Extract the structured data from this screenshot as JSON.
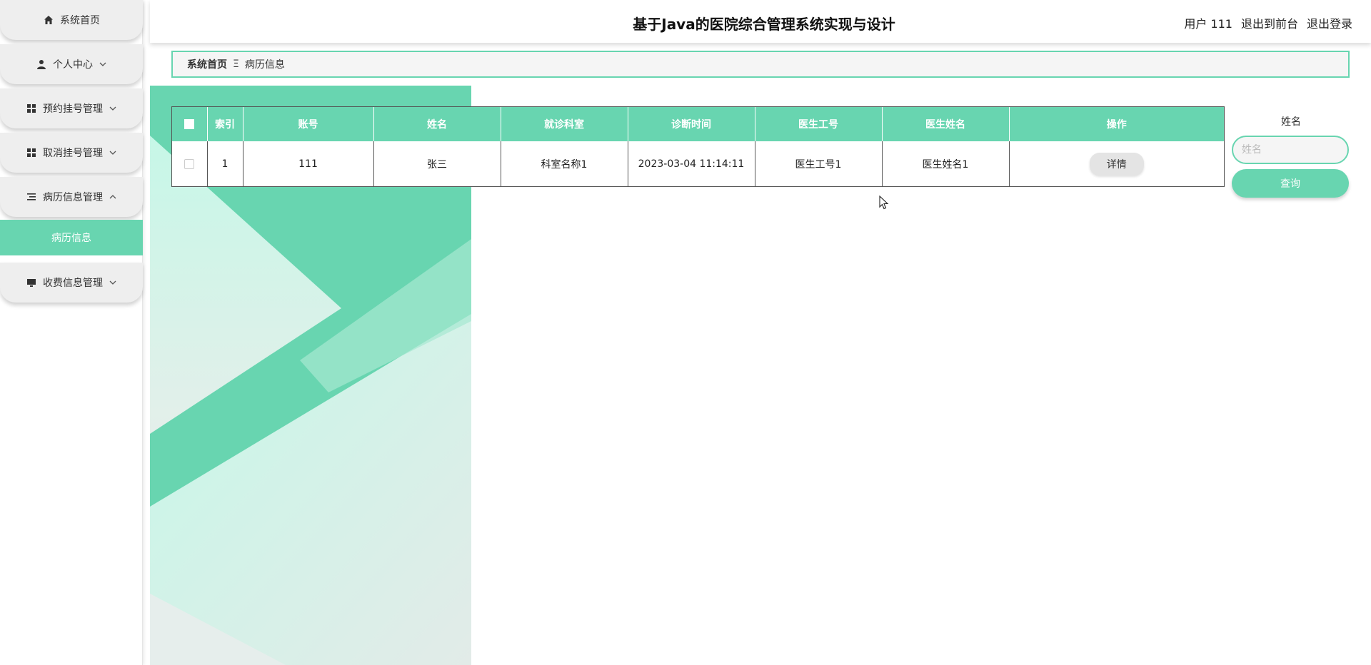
{
  "header": {
    "title": "基于Java的医院综合管理系统实现与设计",
    "user": "用户 111",
    "to_front": "退出到前台",
    "logout": "退出登录"
  },
  "sidebar": {
    "items": [
      {
        "label": "系统首页",
        "icon": "home-icon"
      },
      {
        "label": "个人中心",
        "icon": "user-icon"
      },
      {
        "label": "预约挂号管理",
        "icon": "grid-icon"
      },
      {
        "label": "取消挂号管理",
        "icon": "grid-icon"
      },
      {
        "label": "病历信息管理",
        "icon": "list-icon"
      },
      {
        "label": "收费信息管理",
        "icon": "monitor-icon"
      }
    ],
    "active_sub": "病历信息"
  },
  "breadcrumb": {
    "home": "系统首页",
    "separator": "Ξ",
    "current": "病历信息"
  },
  "table": {
    "columns": [
      "索引",
      "账号",
      "姓名",
      "就诊科室",
      "诊断时间",
      "医生工号",
      "医生姓名",
      "操作"
    ],
    "rows": [
      {
        "index": "1",
        "account": "111",
        "name": "张三",
        "department": "科室名称1",
        "time": "2023-03-04 11:14:11",
        "doctor_id": "医生工号1",
        "doctor_name": "医生姓名1",
        "action": "详情"
      }
    ]
  },
  "search": {
    "label": "姓名",
    "placeholder": "姓名",
    "button": "查询"
  },
  "colors": {
    "accent": "#68d5b0",
    "deco_light": "#c8f5e6"
  }
}
